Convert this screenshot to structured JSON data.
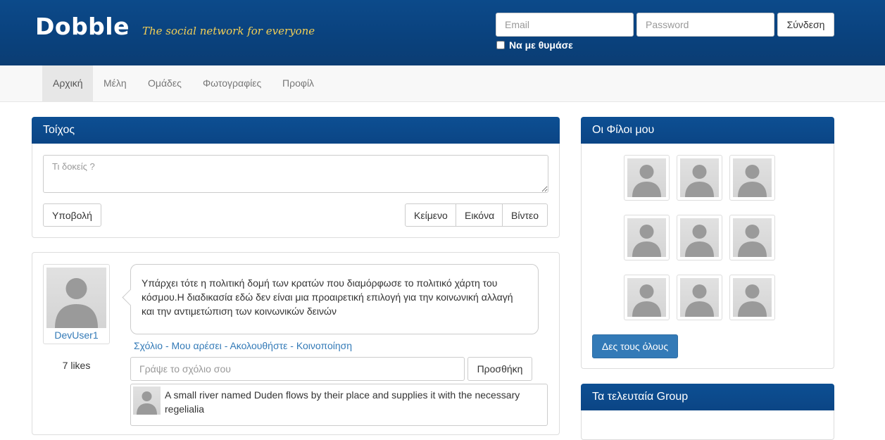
{
  "header": {
    "brand": "Dobble",
    "tagline": "The social network for everyone",
    "email_placeholder": "Email",
    "password_placeholder": "Password",
    "login_label": "Σύνδεση",
    "remember_label": "Να με θυμάσε"
  },
  "nav": {
    "items": [
      {
        "label": "Αρχική",
        "active": true
      },
      {
        "label": "Μέλη"
      },
      {
        "label": "Ομάδες"
      },
      {
        "label": "Φωτογραφίες"
      },
      {
        "label": "Προφίλ"
      }
    ]
  },
  "wall": {
    "title": "Τοίχος",
    "status_placeholder": "Τι δοκείς ?",
    "submit_label": "Υποβολή",
    "type_buttons": [
      "Κείμενο",
      "Εικόνα",
      "Βίντεο"
    ]
  },
  "post": {
    "author": "DevUser1",
    "likes": "7 likes",
    "text": "Υπάρχει τότε η πολιτική δομή των κρατών που διαμόρφωσε το πολιτικό χάρτη του κόσμου.Η διαδικασία εδώ δεν είναι μια προαιρετική επιλογή για την κοινωνική αλλαγή και την αντιμετώπιση των κοινωνικών δεινών",
    "actions": [
      "Σχόλιο",
      "Μου αρέσει",
      "Ακολουθήστε",
      "Κοινοποίηση"
    ],
    "action_separator": "-",
    "comment_placeholder": "Γράψε το σχόλιο σου",
    "add_label": "Προσθήκη",
    "comment_text": "A small river named Duden flows by their place and supplies it with the necessary regelialia"
  },
  "friends": {
    "title": "Οι Φίλοι μου",
    "see_all_label": "Δες τους όλους",
    "count_shown": 9
  },
  "groups": {
    "title": "Τα τελευταία Group"
  },
  "colors": {
    "header_bg": "#0b4585",
    "tagline": "#f3cf55",
    "link": "#337ab7",
    "primary": "#337ab7"
  }
}
